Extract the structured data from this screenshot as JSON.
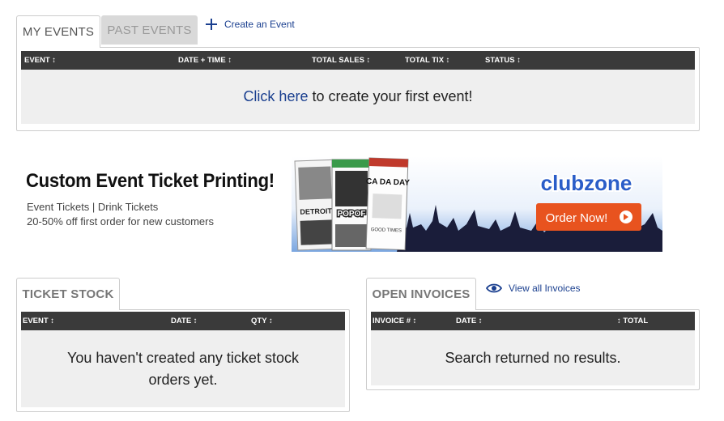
{
  "events": {
    "tabs": {
      "my_events": "MY EVENTS",
      "past_events": "PAST EVENTS"
    },
    "create_link": "Create an Event",
    "columns": [
      "EVENT ↕",
      "DATE + TIME ↕",
      "TOTAL SALES ↕",
      "TOTAL TIX ↕",
      "STATUS ↕"
    ],
    "empty_link": "Click here",
    "empty_text": " to create your first event!"
  },
  "banner": {
    "title": "Custom Event Ticket Printing!",
    "line1": "Event Tickets | Drink Tickets",
    "line2": "20-50% off first order for new customers",
    "brand": "clubzone",
    "cta": "Order Now!",
    "ticket_texts": [
      "DETROIT",
      "POPOF",
      "CA DA DAY",
      "GOOD TIMES"
    ]
  },
  "ticket_stock": {
    "tab": "TICKET STOCK",
    "columns": [
      "EVENT ↕",
      "DATE ↕",
      "QTY ↕"
    ],
    "empty_text": "You haven't created any ticket stock orders yet."
  },
  "invoices": {
    "tab": "OPEN INVOICES",
    "view_link": "View all Invoices",
    "columns": [
      "INVOICE # ↕",
      "DATE ↕",
      "↕ TOTAL"
    ],
    "empty_text": "Search returned no results."
  },
  "colors": {
    "header_bg": "#3a3a3a",
    "body_bg": "#efefef",
    "link": "#1a3f8f",
    "cta": "#e8531f"
  }
}
